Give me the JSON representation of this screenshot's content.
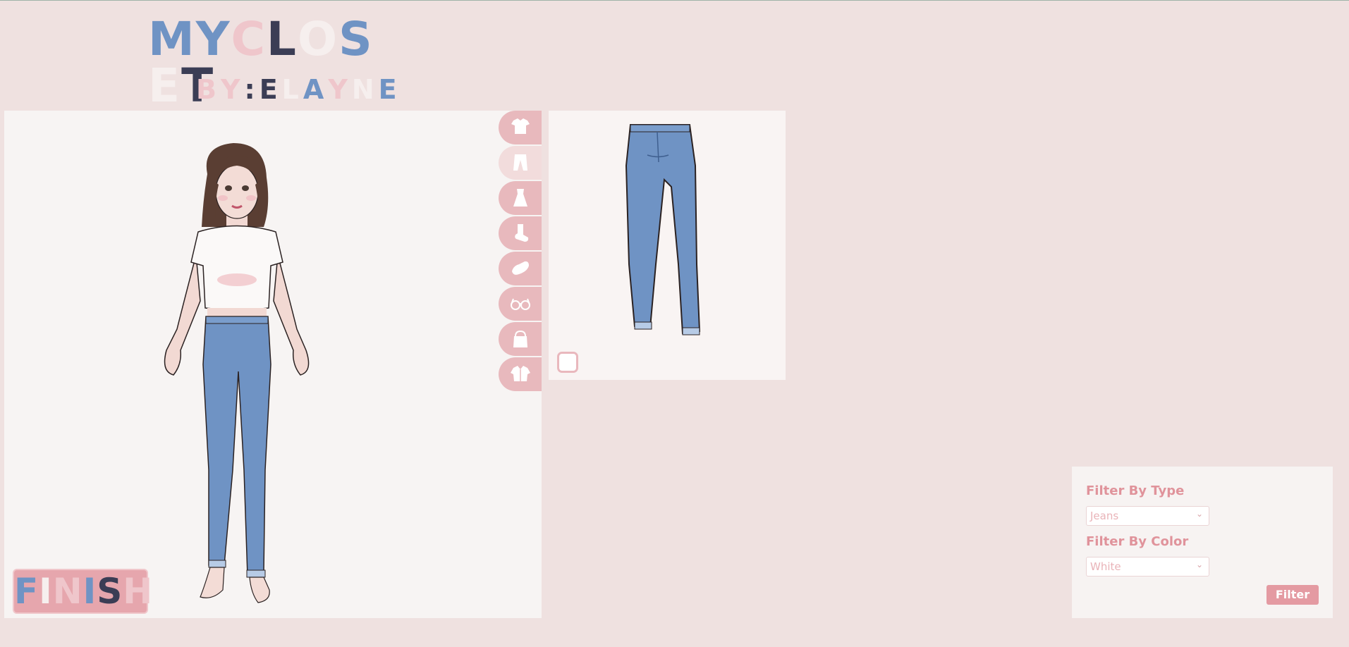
{
  "logo": {
    "line1": [
      {
        "ch": "M",
        "color": "#6f93c4"
      },
      {
        "ch": "Y",
        "color": "#6f93c4"
      },
      {
        "ch": "C",
        "color": "#efc6cb"
      },
      {
        "ch": "L",
        "color": "#3b3d55"
      },
      {
        "ch": "O",
        "color": "#f6efee"
      },
      {
        "ch": "S",
        "color": "#6f93c4"
      },
      {
        "ch": "E",
        "color": "#f6efee"
      },
      {
        "ch": "T",
        "color": "#3b3d55"
      }
    ],
    "line2": [
      {
        "ch": "B",
        "color": "#efc6cb"
      },
      {
        "ch": "Y",
        "color": "#efc6cb"
      },
      {
        "ch": ":",
        "color": "#3b3d55"
      },
      {
        "ch": "E",
        "color": "#3b3d55"
      },
      {
        "ch": "L",
        "color": "#f6efee"
      },
      {
        "ch": "A",
        "color": "#6f93c4"
      },
      {
        "ch": "Y",
        "color": "#efc6cb"
      },
      {
        "ch": "N",
        "color": "#f6efee"
      },
      {
        "ch": "E",
        "color": "#6f93c4"
      }
    ]
  },
  "finish_button": [
    {
      "ch": "F",
      "color": "#6f93c4"
    },
    {
      "ch": "I",
      "color": "#f6efee"
    },
    {
      "ch": "N",
      "color": "#efc6cb"
    },
    {
      "ch": "I",
      "color": "#6f93c4"
    },
    {
      "ch": "S",
      "color": "#3b3d55"
    },
    {
      "ch": "H",
      "color": "#efc6cb"
    }
  ],
  "tabs": [
    {
      "name": "tops",
      "icon": "tshirt-icon",
      "active": false
    },
    {
      "name": "bottoms",
      "icon": "pants-icon",
      "active": true
    },
    {
      "name": "dresses",
      "icon": "dress-icon",
      "active": false
    },
    {
      "name": "socks",
      "icon": "sock-icon",
      "active": false
    },
    {
      "name": "shoes",
      "icon": "shoe-icon",
      "active": false
    },
    {
      "name": "glasses",
      "icon": "glasses-icon",
      "active": false
    },
    {
      "name": "bags",
      "icon": "bag-icon",
      "active": false
    },
    {
      "name": "jackets",
      "icon": "jacket-icon",
      "active": false
    }
  ],
  "filter": {
    "type_label": "Filter By Type",
    "type_value": "Jeans",
    "color_label": "Filter By Color",
    "color_value": "White",
    "button_label": "Filter"
  },
  "colors": {
    "background": "#efe1e0",
    "accent_pink": "#e49aa2",
    "denim": "#6f93c4"
  }
}
